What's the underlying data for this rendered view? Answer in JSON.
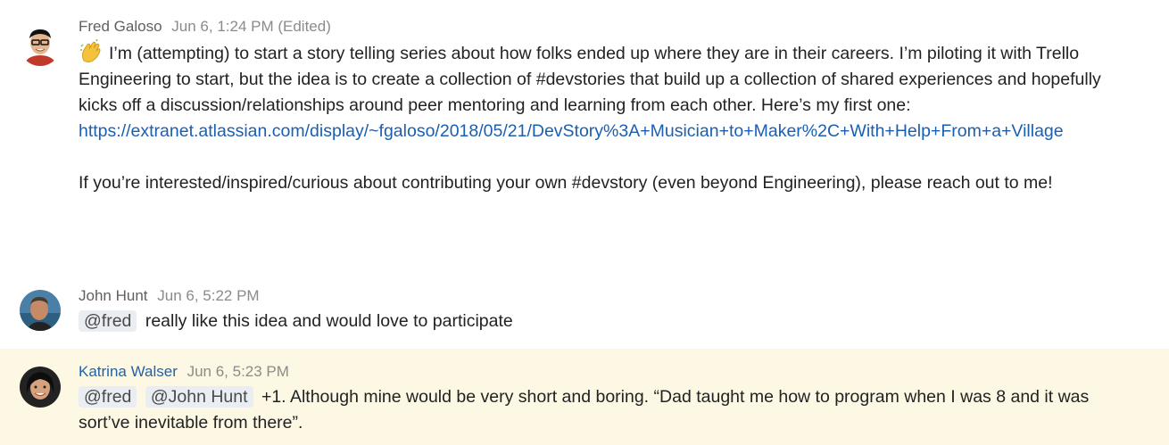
{
  "messages": [
    {
      "author": "Fred Galoso",
      "time": "Jun 6, 1:24 PM (Edited)",
      "text_1": "I’m (attempting) to start a story telling series about how folks ended up where they are in their careers. I’m piloting it with Trello Engineering to start, but the idea is to create a collection of #devstories that build up a collection of shared experiences and hopefully kicks off a discussion/relationships around peer mentoring and learning from each other. Here’s my first one:",
      "link": "https://extranet.atlassian.com/display/~fgaloso/2018/05/21/DevStory%3A+Musician+to+Maker%2C+With+Help+From+a+Village",
      "text_2": "If you’re interested/inspired/curious about contributing your own #devstory (even beyond Engineering), please reach out to me!",
      "emoji": "clapping-hands-icon"
    },
    {
      "author": "John Hunt",
      "time": "Jun 6, 5:22 PM",
      "mention_1": "@fred",
      "text": "really like this idea and would love to participate"
    },
    {
      "author": "Katrina Walser",
      "time": "Jun 6, 5:23 PM",
      "mention_1": "@fred",
      "mention_2": "@John Hunt",
      "text": "+1. Although mine would be very short and boring. “Dad taught me how to program when I was 8 and it was sort’ve inevitable from there”."
    }
  ],
  "colors": {
    "highlight_bg": "#fcf8e4",
    "link": "#1a5fb0",
    "mention_bg": "#eaeef2",
    "author_blue": "#1f63a8"
  }
}
